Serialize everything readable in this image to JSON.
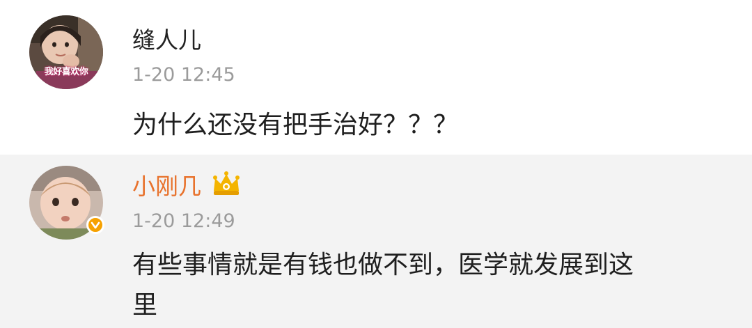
{
  "comments": [
    {
      "username": "缝人儿",
      "avatar_caption": "我好喜欢你",
      "time": "1-20 12:45",
      "text": "为什么还没有把手治好？？？"
    },
    {
      "username": "小刚几",
      "time": "1-20 12:49",
      "text_lines": [
        "有些事情就是有钱也做不到，医学就发展到这",
        "里"
      ],
      "username_color": "#e8722c",
      "verified_color": "#f6a100",
      "crown_color": "#f4b400"
    }
  ]
}
